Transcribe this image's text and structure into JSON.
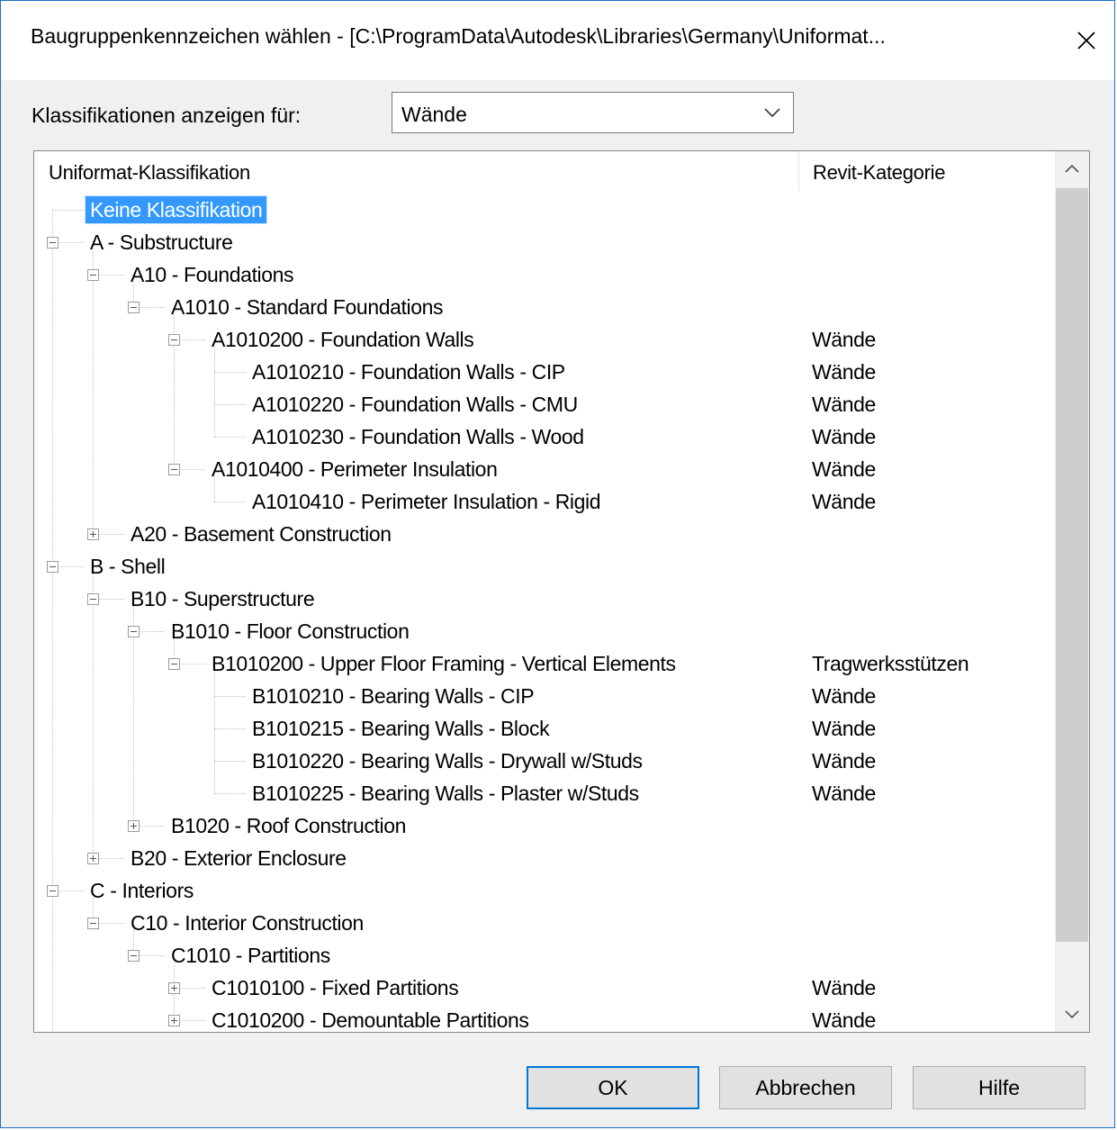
{
  "window": {
    "title": "Baugruppenkennzeichen wählen - [C:\\ProgramData\\Autodesk\\Libraries\\Germany\\Uniformat..."
  },
  "filter": {
    "label": "Klassifikationen anzeigen für:",
    "selected": "Wände"
  },
  "tree": {
    "columns": [
      "Uniformat-Klassifikation",
      "Revit-Kategorie"
    ],
    "rows": [
      {
        "label": "Keine Klassifikation",
        "category": "",
        "level": 0,
        "expander": "none",
        "selected": true
      },
      {
        "label": "A - Substructure",
        "category": "",
        "level": 0,
        "expander": "expanded"
      },
      {
        "label": "A10 - Foundations",
        "category": "",
        "level": 1,
        "expander": "expanded"
      },
      {
        "label": "A1010 - Standard Foundations",
        "category": "",
        "level": 2,
        "expander": "expanded"
      },
      {
        "label": "A1010200 - Foundation Walls",
        "category": "Wände",
        "level": 3,
        "expander": "expanded"
      },
      {
        "label": "A1010210 - Foundation Walls - CIP",
        "category": "Wände",
        "level": 4,
        "expander": "none"
      },
      {
        "label": "A1010220 - Foundation Walls - CMU",
        "category": "Wände",
        "level": 4,
        "expander": "none"
      },
      {
        "label": "A1010230 - Foundation Walls - Wood",
        "category": "Wände",
        "level": 4,
        "expander": "none"
      },
      {
        "label": "A1010400 - Perimeter Insulation",
        "category": "Wände",
        "level": 3,
        "expander": "expanded"
      },
      {
        "label": "A1010410 - Perimeter Insulation - Rigid",
        "category": "Wände",
        "level": 4,
        "expander": "none"
      },
      {
        "label": "A20 - Basement Construction",
        "category": "",
        "level": 1,
        "expander": "collapsed"
      },
      {
        "label": "B - Shell",
        "category": "",
        "level": 0,
        "expander": "expanded"
      },
      {
        "label": "B10 - Superstructure",
        "category": "",
        "level": 1,
        "expander": "expanded"
      },
      {
        "label": "B1010 - Floor Construction",
        "category": "",
        "level": 2,
        "expander": "expanded"
      },
      {
        "label": "B1010200 - Upper Floor Framing - Vertical Elements",
        "category": "Tragwerksstützen",
        "level": 3,
        "expander": "expanded"
      },
      {
        "label": "B1010210 - Bearing Walls - CIP",
        "category": "Wände",
        "level": 4,
        "expander": "none"
      },
      {
        "label": "B1010215 - Bearing Walls - Block",
        "category": "Wände",
        "level": 4,
        "expander": "none"
      },
      {
        "label": "B1010220 - Bearing Walls - Drywall w/Studs",
        "category": "Wände",
        "level": 4,
        "expander": "none"
      },
      {
        "label": "B1010225 - Bearing Walls - Plaster w/Studs",
        "category": "Wände",
        "level": 4,
        "expander": "none"
      },
      {
        "label": "B1020 - Roof Construction",
        "category": "",
        "level": 2,
        "expander": "collapsed"
      },
      {
        "label": "B20 - Exterior Enclosure",
        "category": "",
        "level": 1,
        "expander": "collapsed"
      },
      {
        "label": "C - Interiors",
        "category": "",
        "level": 0,
        "expander": "expanded"
      },
      {
        "label": "C10 - Interior Construction",
        "category": "",
        "level": 1,
        "expander": "expanded"
      },
      {
        "label": "C1010 - Partitions",
        "category": "",
        "level": 2,
        "expander": "expanded"
      },
      {
        "label": "C1010100 - Fixed Partitions",
        "category": "Wände",
        "level": 3,
        "expander": "collapsed"
      },
      {
        "label": "C1010200 - Demountable Partitions",
        "category": "Wände",
        "level": 3,
        "expander": "collapsed"
      }
    ]
  },
  "buttons": {
    "ok": "OK",
    "cancel": "Abbrechen",
    "help": "Hilfe"
  },
  "colors": {
    "accent": "#0078d7",
    "selection": "#3399ff",
    "window_border": "#1a73c8",
    "dialog_bg": "#f0f0f0"
  },
  "icons": {
    "close": "close-icon",
    "dropdown": "chevron-down-icon",
    "scroll_up": "chevron-up-icon",
    "scroll_down": "chevron-down-icon",
    "expand": "plus-box-icon",
    "collapse": "minus-box-icon"
  }
}
